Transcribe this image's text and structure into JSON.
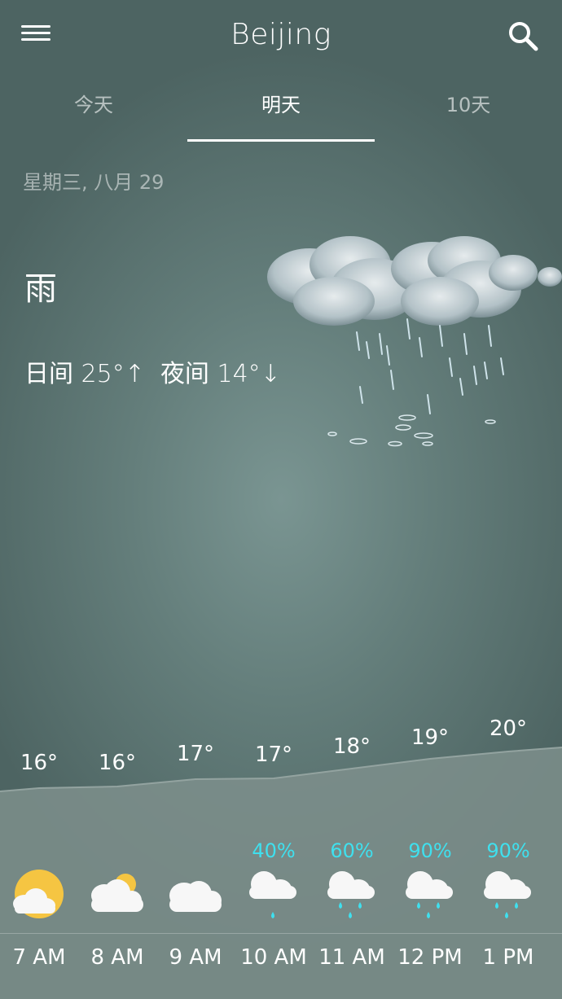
{
  "header": {
    "title": "Beijing"
  },
  "tabs": [
    {
      "label": "今天"
    },
    {
      "label": "明天"
    },
    {
      "label": "10天"
    }
  ],
  "date": "星期三, 八月 29",
  "current": {
    "condition": "雨",
    "day_label": "日间",
    "day_temp": "25°↑",
    "night_label": "夜间",
    "night_temp": "14°↓"
  },
  "hourly": [
    {
      "time": "7 AM",
      "temp": "16°",
      "precip": "",
      "icon": "sun-cloud-icon"
    },
    {
      "time": "8 AM",
      "temp": "16°",
      "precip": "",
      "icon": "partly-cloudy-icon"
    },
    {
      "time": "9 AM",
      "temp": "17°",
      "precip": "",
      "icon": "cloudy-icon"
    },
    {
      "time": "10 AM",
      "temp": "17°",
      "precip": "40%",
      "icon": "light-rain-icon"
    },
    {
      "time": "11 AM",
      "temp": "18°",
      "precip": "60%",
      "icon": "rain-icon"
    },
    {
      "time": "12 PM",
      "temp": "19°",
      "precip": "90%",
      "icon": "rain-icon"
    },
    {
      "time": "1 PM",
      "temp": "20°",
      "precip": "90%",
      "icon": "rain-icon"
    }
  ],
  "colors": {
    "accent_precip": "#3fe0ee",
    "sun": "#f5c542"
  }
}
